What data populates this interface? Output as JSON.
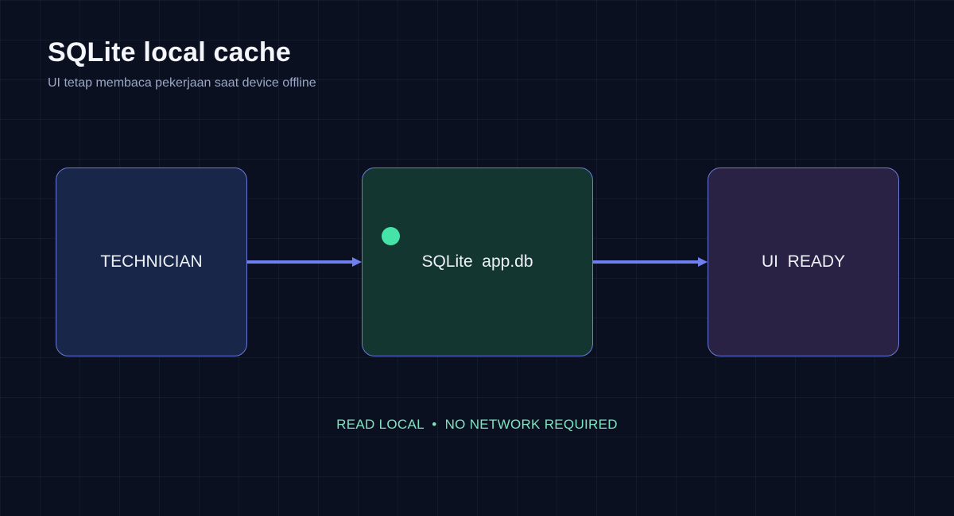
{
  "header": {
    "title": "SQLite local cache",
    "subtitle": "UI tetap membaca pekerjaan saat device offline"
  },
  "nodes": [
    {
      "id": "technician",
      "label": "TECHNICIAN",
      "fill": "#182749"
    },
    {
      "id": "sqlite",
      "label": "SQLite  app.db",
      "fill": "#143631",
      "status_dot_color": "#45e3a8"
    },
    {
      "id": "ui-ready",
      "label": "UI  READY",
      "fill": "#2a2244"
    }
  ],
  "edges": [
    {
      "from": "technician",
      "to": "sqlite"
    },
    {
      "from": "sqlite",
      "to": "ui-ready"
    }
  ],
  "footer": {
    "note": "READ LOCAL  •  NO NETWORK REQUIRED"
  },
  "colors": {
    "background": "#0a101f",
    "border": "#6b7ad6",
    "arrow": "#6f7ff0",
    "footer_text": "#7fe3c2"
  }
}
